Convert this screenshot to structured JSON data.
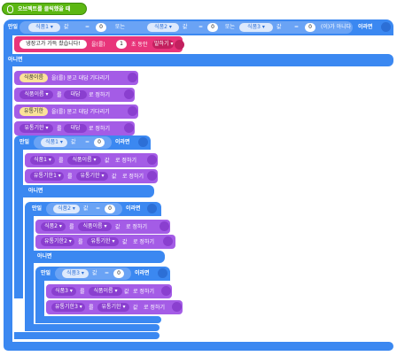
{
  "hat": {
    "label": "오브젝트를 클릭했을 때"
  },
  "outer_if": {
    "if_label": "만일",
    "sensor1": "식품1 ▾",
    "field": "값",
    "eq": "=",
    "zero": "0",
    "or1": "또는",
    "sensor2": "식품2 ▾",
    "or2": "또는",
    "sensor3": "식품3 ▾",
    "tail": "(이)가 아니다",
    "then": "이라면"
  },
  "fridge_say": {
    "text": "냉장고가 가득 찼습니다!",
    "word": "을(를)",
    "secs": "1",
    "suffix": "초 동안",
    "mode": "말하기 ▾"
  },
  "else_label": "아니면",
  "ask1": {
    "var": "식품이름",
    "text": "을(를) 묻고 대답 기다리기"
  },
  "set1": {
    "var": "식품이름 ▾",
    "mid": "를",
    "val": "대답",
    "tail": "로 정하기"
  },
  "ask2": {
    "var": "유통기한",
    "text": "을(를) 묻고 대답 기다리기"
  },
  "set2": {
    "var": "유통기한 ▾",
    "mid": "를",
    "val": "대답",
    "tail": "로 정하기"
  },
  "if1": {
    "if_label": "만일",
    "sensor": "식품1 ▾",
    "field": "값",
    "eq": "=",
    "zero": "0",
    "then": "이라면"
  },
  "if1_set1": {
    "var": "식품1 ▾",
    "mid": "를",
    "src": "식품이름 ▾",
    "field": "값",
    "tail": "로 정하기"
  },
  "if1_set2": {
    "var": "유통기한1 ▾",
    "mid": "를",
    "src": "유통기한 ▾",
    "field": "값",
    "tail": "로 정하기"
  },
  "else2_label": "아니면",
  "if2": {
    "if_label": "만일",
    "sensor": "식품2 ▾",
    "field": "값",
    "eq": "=",
    "zero": "0",
    "then": "이라면"
  },
  "if2_set1": {
    "var": "식품2 ▾",
    "mid": "를",
    "src": "식품이름 ▾",
    "field": "값",
    "tail": "로 정하기"
  },
  "if2_set2": {
    "var": "유통기한2 ▾",
    "mid": "를",
    "src": "유통기한 ▾",
    "field": "값",
    "tail": "로 정하기"
  },
  "else3_label": "아니면",
  "if3": {
    "if_label": "만일",
    "sensor": "식품3 ▾",
    "field": "값",
    "eq": "=",
    "zero": "0",
    "then": "이라면"
  },
  "if3_set1": {
    "var": "식품3 ▾",
    "mid": "를",
    "src": "식품이름 ▾",
    "field": "값",
    "tail": "로 정하기"
  },
  "if3_set2": {
    "var": "유통기한3 ▾",
    "mid": "를",
    "src": "유통기한 ▾",
    "field": "값",
    "tail": "로 정하기"
  },
  "colors": {
    "hat": "#5cb712",
    "control": "#3b88f1",
    "data": "#a45ce6",
    "looks": "#e8347a",
    "condition": "#6aa3f5",
    "var_pill": "#fbe29a"
  }
}
